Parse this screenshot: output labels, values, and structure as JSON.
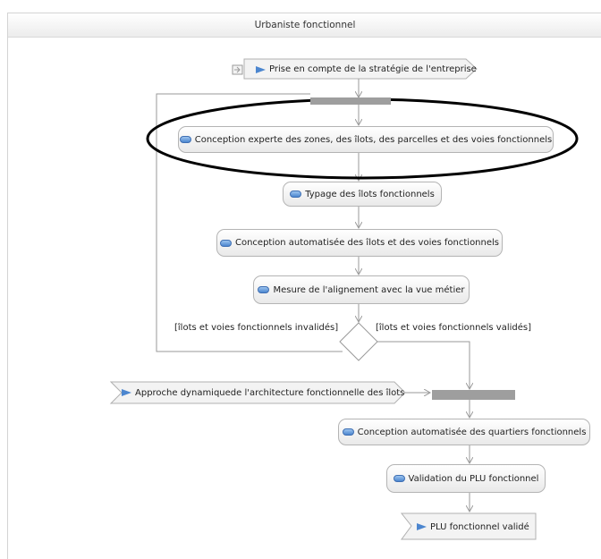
{
  "diagram": {
    "title": "Urbaniste fonctionnel",
    "input_signal": "Prise en compte de la stratégie de l'entreprise",
    "actions": [
      "Conception experte des zones, des îlots, des parcelles et des voies fonctionnels",
      "Typage des îlots fonctionnels",
      "Conception automatisée des îlots et des voies fonctionnels",
      "Mesure de l'alignement avec la vue métier",
      "Conception automatisée des quartiers fonctionnels",
      "Validation du PLU fonctionnel"
    ],
    "guard_invalid": "[îlots et voies fonctionnels invalidés]",
    "guard_valid": "[îlots et voies fonctionnels validés]",
    "second_input": "Approche dynamiquede l'architecture fonctionnelle des îlots",
    "output_signal": "PLU fonctionnel validé"
  }
}
